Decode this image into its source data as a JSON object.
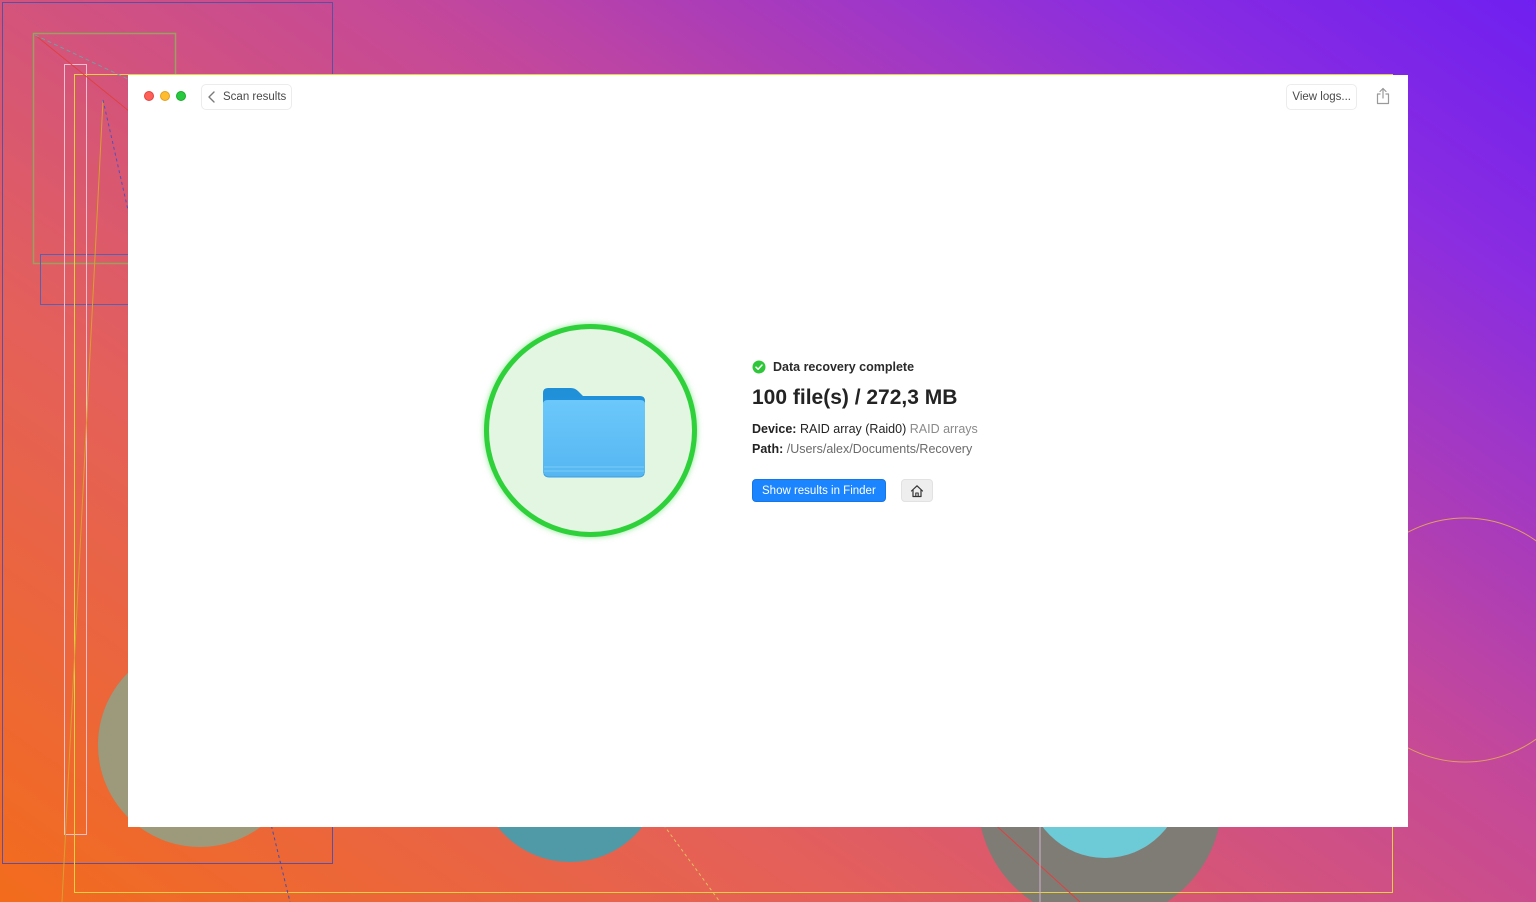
{
  "titlebar": {
    "back_label": "Scan results",
    "view_logs_label": "View logs...",
    "share_icon": "share-icon"
  },
  "result": {
    "status_text": "Data recovery complete",
    "summary": "100 file(s) / 272,3 MB",
    "device_key": "Device:",
    "device_value": "RAID array (Raid0)",
    "device_type": "RAID arrays",
    "path_key": "Path:",
    "path_value": "/Users/alex/Documents/Recovery"
  },
  "actions": {
    "show_finder_label": "Show results in Finder",
    "home_icon": "home-icon"
  },
  "colors": {
    "accent_blue": "#1b84ff",
    "success_green": "#2fd13a",
    "folder_blue": "#5bbcf6"
  }
}
